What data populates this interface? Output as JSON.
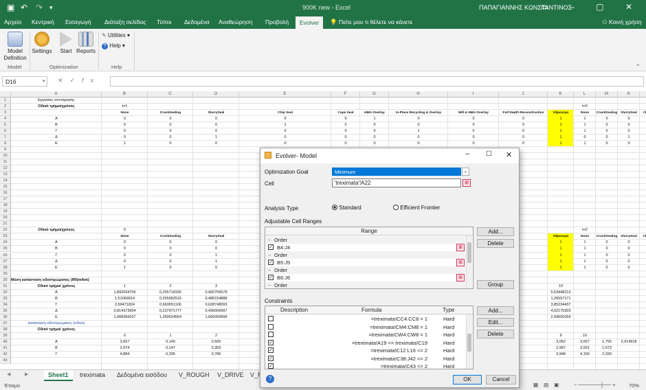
{
  "titlebar": {
    "doc_title": "900K new - Excel",
    "user": "ΠΑΠΑΓΙΑΝΝΗΣ ΚΩΝΣΤΑΝΤΙΝΟΣ"
  },
  "ribbon_tabs": [
    "Αρχείο",
    "Κεντρική",
    "Εισαγωγή",
    "Διάταξη σελίδας",
    "Τύποι",
    "Δεδομένα",
    "Αναθεώρηση",
    "Προβολή",
    "Evolver"
  ],
  "tell_me": "Πείτε μου τι θέλετε να κάνετε",
  "share": "Κοινή χρήση",
  "ribbon": {
    "model_definition": "Model Definition",
    "settings": "Settings",
    "start": "Start",
    "reports": "Reports",
    "utilities": "Utilities",
    "help": "Help",
    "group_model": "Model",
    "group_optimization": "Optimization",
    "group_help": "Help"
  },
  "formula_bar": {
    "name_box": "D16",
    "fx": "fx",
    "value": ""
  },
  "columns": [
    "A",
    "B",
    "C",
    "D",
    "E",
    "F",
    "G",
    "H",
    "I",
    "J",
    "K",
    "L",
    "M",
    "N",
    "O"
  ],
  "rows": [
    "1",
    "2",
    "3",
    "4",
    "5",
    "6",
    "7",
    "8",
    "9",
    "10",
    "11",
    "12",
    "13",
    "14",
    "15",
    "16",
    "17",
    "18",
    "19",
    "20",
    "21",
    "22",
    "23",
    "24",
    "25",
    "26",
    "27",
    "28",
    "29",
    "30",
    "31",
    "32",
    "33",
    "34",
    "35",
    "36",
    "37",
    "38",
    "39",
    "40",
    "41",
    "42",
    "43"
  ],
  "sheet": {
    "a1": "Εργασίες συντήρησης",
    "a2": "Οδικό τμήμα/χρόνος",
    "t1": "t=1",
    "t2": "t=2",
    "zero": "0",
    "header3": [
      "None",
      "CrackSealing",
      "SlurrySeal",
      "Chip Seal",
      "Cape Seal",
      "HMA Overlay",
      "In-Place Recycling & Overlay",
      "Mill & HMA Overlay",
      "Full Depth Reconstruction",
      "Άθροισμα",
      "None",
      "CrackSealing",
      "SlurrySeal",
      "Chip Seal"
    ],
    "labels": [
      "Α",
      "Β",
      "Γ",
      "Δ",
      "Ε"
    ],
    "top_rows": [
      [
        "0",
        "0",
        "0",
        "0",
        "0",
        "1",
        "0",
        "0",
        "0",
        "1",
        "1",
        "0",
        "0",
        "0"
      ],
      [
        "0",
        "0",
        "0",
        "1",
        "0",
        "0",
        "0",
        "0",
        "0",
        "1",
        "1",
        "0",
        "0",
        "1"
      ],
      [
        "0",
        "0",
        "0",
        "0",
        "0",
        "0",
        "1",
        "0",
        "0",
        "1",
        "1",
        "0",
        "0",
        "0"
      ],
      [
        "0",
        "0",
        "1",
        "0",
        "0",
        "0",
        "0",
        "0",
        "0",
        "1",
        "0",
        "0",
        "1",
        "0"
      ],
      [
        "1",
        "0",
        "0",
        "0",
        "0",
        "0",
        "0",
        "0",
        "0",
        "1",
        "1",
        "0",
        "0",
        "0"
      ]
    ],
    "a22": "Οδικό τμήμα/χρόνος",
    "header23": [
      "None",
      "CrackSealing",
      "SlurrySeal",
      "Άθροισμα",
      "None",
      "CrackSealing",
      "SlurrySeal",
      "Chip Seal"
    ],
    "mid_rows": [
      [
        "0",
        "0",
        "0",
        "1",
        "1",
        "0",
        "0",
        "0"
      ],
      [
        "0",
        "0",
        "0",
        "1",
        "1",
        "0",
        "0",
        "0"
      ],
      [
        "0",
        "0",
        "1",
        "1",
        "1",
        "0",
        "0",
        "0"
      ],
      [
        "0",
        "0",
        "1",
        "1",
        "1",
        "0",
        "0",
        "0"
      ],
      [
        "1",
        "0",
        "0",
        "1",
        "1",
        "0",
        "0",
        "0"
      ]
    ],
    "a30": "Μέση κατάσταση οδοστρώματος (IRI(m/km)",
    "a31": "Οδικό τμήμα/ χρόνος",
    "row31": [
      "1",
      "2",
      "3",
      "10"
    ],
    "iri_rows": [
      [
        "1,892634706",
        "0,255718155",
        "0,400706578",
        "5,53448213"
      ],
      [
        "1,51069914",
        "0,255582515",
        "0,486154888",
        "1,25557171"
      ],
      [
        "2,69471824",
        "0,660651106",
        "0,628748093",
        "3,85234437"
      ],
      [
        "0,814373654",
        "0,237971777",
        "0,436006697",
        "4,02175303"
      ],
      [
        "1,068356037",
        "1,350624564",
        "1,666059599",
        "2,99600359"
      ]
    ],
    "a37": "κατάσταση οδοστρώματος (m/km)",
    "a38": "Οδικό τμήμα/ χρόνος",
    "row39": [
      "0",
      "1",
      "2",
      "9",
      "10"
    ],
    "cond_rows": [
      [
        "3,657",
        "0,140",
        "0,565",
        "3,052",
        "3,657",
        "1,755",
        "2,014918"
      ],
      [
        "2,074",
        "0,147",
        "0,359",
        "2,997",
        "3,501",
        "1,673",
        ""
      ],
      [
        "4,884",
        "0,335",
        "0,786",
        "3,948",
        "4,156",
        "2,339",
        ""
      ]
    ]
  },
  "sheet_tabs": [
    "Sheet1",
    "treximata",
    "Δεδομένα εισόδου",
    "V_ROUGH",
    "V_DRIVE",
    "V_R"
  ],
  "status": {
    "ready": "Έτοιμο",
    "zoom": "70%"
  },
  "dialog": {
    "title": "Evolver- Model",
    "optimization_goal_label": "Optimization Goal",
    "optimization_goal_value": "Minimum",
    "cell_label": "Cell",
    "cell_value": "'treximata'!A22",
    "analysis_type_label": "Analysis Type",
    "standard": "Standard",
    "efficient_frontier": "Efficient Frontier",
    "adjustable_label": "Adjustable Cell Ranges",
    "range_header": "Range",
    "ranges": [
      {
        "kind": "group",
        "text": "Order"
      },
      {
        "kind": "item",
        "text": "B4:J4",
        "checked": true
      },
      {
        "kind": "group",
        "text": "Order"
      },
      {
        "kind": "item",
        "text": "B5:J5",
        "checked": true
      },
      {
        "kind": "group",
        "text": "Order"
      },
      {
        "kind": "item",
        "text": "B6:J6",
        "checked": true
      },
      {
        "kind": "group",
        "text": "Order"
      }
    ],
    "add": "Add...",
    "delete": "Delete",
    "group": "Group",
    "constraints_label": "Constraints",
    "c_desc": "Description",
    "c_formula": "Formula",
    "c_type": "Type",
    "constraints": [
      {
        "formula": "=treximata!CC4:CC8 = 1",
        "type": "Hard",
        "checked": false
      },
      {
        "formula": "=treximata!CM4:CM8 = 1",
        "type": "Hard",
        "checked": false
      },
      {
        "formula": "=treximata!CW4:CW8 = 1",
        "type": "Hard",
        "checked": false
      },
      {
        "formula": "=treximata!A19 <= treximata!C19",
        "type": "Hard",
        "checked": true
      },
      {
        "formula": "=treximata!C12:L16 <= 2",
        "type": "Hard",
        "checked": true
      },
      {
        "formula": "=treximata!C38:J42 <= 2",
        "type": "Hard",
        "checked": true
      },
      {
        "formula": "=treximata!C43 <= 2",
        "type": "Hard",
        "checked": true
      }
    ],
    "c_add": "Add...",
    "c_edit": "Edit...",
    "c_delete": "Delete",
    "ok": "OK",
    "cancel": "Cancel"
  }
}
